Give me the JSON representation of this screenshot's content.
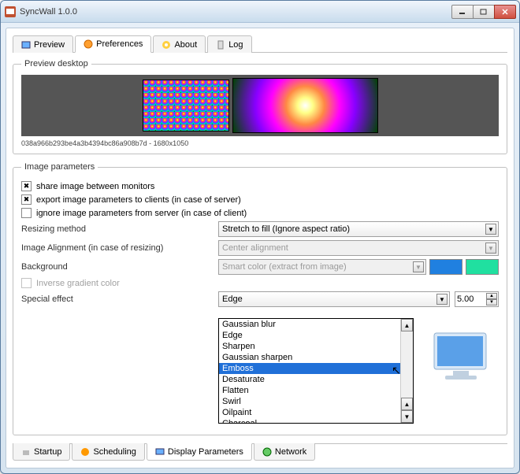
{
  "window": {
    "title": "SyncWall 1.0.0"
  },
  "tabs_top": {
    "preview": "Preview",
    "preferences": "Preferences",
    "about": "About",
    "log": "Log"
  },
  "preview_section": {
    "legend": "Preview  desktop",
    "caption": "038a966b293be4a3b4394bc86a908b7d - 1680x1050"
  },
  "params": {
    "legend": "Image parameters",
    "share_label": "share image between monitors",
    "share_checked": true,
    "export_label": "export image parameters to clients (in case of server)",
    "export_checked": true,
    "ignore_label": "ignore image parameters from server (in case of client)",
    "ignore_checked": false,
    "resizing_label": "Resizing method",
    "resizing_value": "Stretch to fill (Ignore aspect ratio)",
    "alignment_label": "Image Alignment (in case of resizing)",
    "alignment_value": "Center alignment",
    "background_label": "Background",
    "background_value": "Smart color (extract from image)",
    "inverse_label": "Inverse gradient color",
    "special_label": "Special effect",
    "special_value": "Edge",
    "special_spin": "5.00",
    "swatch1": "#2278d8",
    "swatch2": "#1fe4a5"
  },
  "dropdown": {
    "items": [
      "Gaussian blur",
      "Edge",
      "Sharpen",
      "Gaussian sharpen",
      "Emboss",
      "Desaturate",
      "Flatten",
      "Swirl",
      "Oilpaint",
      "Charcoal"
    ],
    "highlight": "Emboss"
  },
  "tabs_bottom": {
    "startup": "Startup",
    "scheduling": "Scheduling",
    "display": "Display Parameters",
    "network": "Network"
  }
}
